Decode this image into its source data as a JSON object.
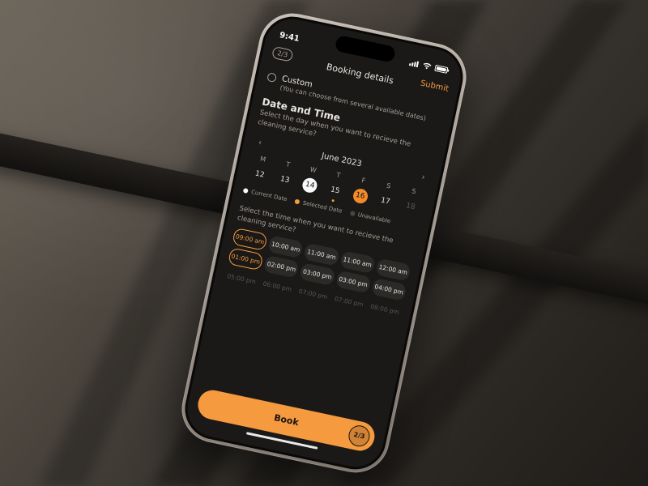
{
  "statusbar": {
    "time": "9:41"
  },
  "header": {
    "title": "Booking details",
    "step": "2/3",
    "submit": "Submit"
  },
  "custom": {
    "label": "Custom",
    "sub": "(You can choose from several available dates)"
  },
  "section": {
    "title": "Date and Time",
    "date_prompt": "Select the day when you want to recieve the cleaning service?",
    "time_prompt": "Select the time when you want to recieve the cleaning service?"
  },
  "calendar": {
    "month": "June 2023",
    "dow": [
      "M",
      "T",
      "W",
      "T",
      "F",
      "S",
      "S"
    ],
    "days": [
      "12",
      "13",
      "14",
      "15",
      "16",
      "17",
      "18"
    ],
    "current_index": 2,
    "selected_index": 4,
    "unavailable_index": 6
  },
  "legend": {
    "current": "Current Date",
    "selected": "Selected Date",
    "unavailable": "Unavailable"
  },
  "time_slots": {
    "row1": [
      "09:00 am",
      "10:00 am",
      "11:00 am",
      "11:00 am",
      "12:00 am"
    ],
    "row2": [
      "01:00 pm",
      "02:00 pm",
      "03:00 pm",
      "03:00 pm",
      "04:00 pm"
    ],
    "row3": [
      "05:00 pm",
      "06:00 pm",
      "07:00 pm",
      "07:00 pm",
      "08:00 pm"
    ],
    "selected": [
      "09:00 am",
      "01:00 pm"
    ]
  },
  "footer": {
    "book": "Book",
    "step": "2/3"
  }
}
